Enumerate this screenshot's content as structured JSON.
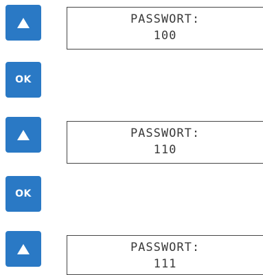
{
  "steps": [
    {
      "button": {
        "icon": "up-arrow-icon"
      },
      "display": {
        "label": "PASSWORT:",
        "value": "100"
      }
    },
    {
      "button": {
        "label": "OK"
      }
    },
    {
      "button": {
        "icon": "up-arrow-icon"
      },
      "display": {
        "label": "PASSWORT:",
        "value": "110"
      }
    },
    {
      "button": {
        "label": "OK"
      }
    },
    {
      "button": {
        "icon": "up-arrow-icon"
      },
      "display": {
        "label": "PASSWORT:",
        "value": "111"
      }
    }
  ],
  "colors": {
    "button_blue": "#2a79c5",
    "display_border": "#444444",
    "display_text": "#3a3a3a"
  }
}
